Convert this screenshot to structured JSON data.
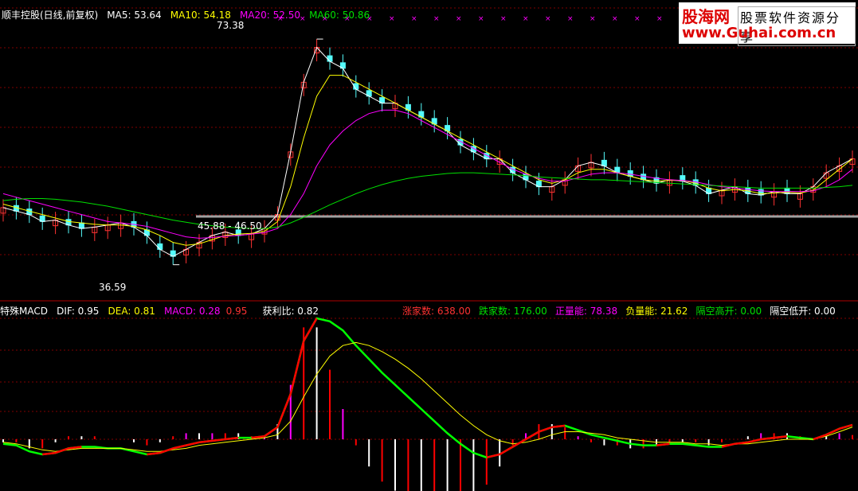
{
  "header": {
    "stock": "顺丰控股(日线,前复权)",
    "ma5": "MA5: 53.64",
    "ma10": "MA10: 54.18",
    "ma20": "MA20: 52.50",
    "ma60": "MA60: 50.86"
  },
  "macd_header": {
    "name": "特殊MACD",
    "dif": "DIF: 0.95",
    "dea": "DEA: 0.81",
    "macd_a": "MACD: 0.28",
    "macd_b": "0.95",
    "profit": "获利比: 0.82",
    "up_count": "涨家数: 638.00",
    "down_count": "跌家数: 176.00",
    "pos_vol": "正量能: 78.38",
    "neg_vol": "负量能: 21.62",
    "gap_up": "隔空高开: 0.00",
    "gap_down": "隔空低开: 0.00"
  },
  "logo": {
    "name": "股海网",
    "slogan": "股票软件资源分享",
    "url": "www.Guhai.com.cn"
  },
  "annotations": {
    "high": "73.38",
    "low": "36.59",
    "range": "45.88 - 46.50"
  },
  "colors": {
    "up": "#ff3232",
    "down": "#54fcfc",
    "ma5": "#ffffff",
    "ma10": "#ffff00",
    "ma20": "#ff00ff",
    "ma60": "#00e000",
    "grid": "#800000",
    "macd_up": "#ff0000",
    "macd_down": "#00ff00"
  },
  "chart_data": {
    "type": "line",
    "price_axis": [
      36.59,
      73.38
    ],
    "series": [
      {
        "name": "MA5",
        "values": [
          47,
          46.5,
          46,
          45,
          45.2,
          44.5,
          44,
          44.2,
          44.5,
          44.8,
          44.2,
          43,
          41,
          40,
          41,
          42,
          43,
          43.5,
          43,
          43.2,
          44,
          46,
          55,
          65,
          70,
          68,
          67,
          64,
          63,
          62,
          62,
          61,
          60,
          59,
          58,
          56,
          55,
          54,
          54,
          52,
          51,
          50,
          50,
          51,
          53,
          53.5,
          53,
          52,
          51.5,
          51,
          50.5,
          51,
          50.8,
          50.2,
          49,
          49.5,
          50,
          49,
          48.8,
          49.3,
          49,
          49,
          50,
          52,
          53,
          54
        ]
      },
      {
        "name": "MA10",
        "values": [
          47.5,
          47,
          46.5,
          46,
          45.5,
          45,
          44.8,
          44.6,
          44.5,
          44.5,
          44.3,
          43.8,
          43,
          42,
          41.6,
          41.8,
          42.4,
          43,
          43.2,
          43.3,
          43.6,
          45,
          50,
          57,
          63,
          66,
          66,
          65,
          64,
          63,
          62,
          61,
          60,
          59,
          58,
          57,
          56,
          55,
          54,
          53,
          52,
          51,
          50.5,
          51,
          52,
          52.5,
          52.5,
          52,
          51.5,
          51,
          50.8,
          50.9,
          50.9,
          50.5,
          49.8,
          49.4,
          49.6,
          49.4,
          49,
          49.1,
          49.2,
          49.1,
          49.5,
          51,
          52.5,
          54
        ]
      },
      {
        "name": "MA20",
        "values": [
          49,
          48.5,
          48,
          47.5,
          47,
          46.5,
          46,
          45.5,
          45,
          44.8,
          44.6,
          44.3,
          43.8,
          43.3,
          42.8,
          42.6,
          42.7,
          42.9,
          43,
          43.2,
          43.4,
          44,
          46,
          49,
          53,
          56,
          58,
          59.5,
          60.5,
          61,
          61,
          60.5,
          59.5,
          58.5,
          57.5,
          56.5,
          55.5,
          54.5,
          53.5,
          52.5,
          51.8,
          51.2,
          50.8,
          50.8,
          51.3,
          51.8,
          52,
          52,
          51.8,
          51.5,
          51.2,
          51,
          50.9,
          50.7,
          50.3,
          50,
          49.8,
          49.6,
          49.4,
          49.3,
          49.3,
          49.3,
          49.4,
          50,
          51,
          52.5
        ]
      },
      {
        "name": "MA60",
        "values": [
          48,
          48.2,
          48.3,
          48.3,
          48.2,
          48,
          47.8,
          47.5,
          47.2,
          46.8,
          46.4,
          46,
          45.6,
          45.2,
          44.9,
          44.6,
          44.4,
          44.2,
          44.1,
          44,
          44,
          44.2,
          44.8,
          45.6,
          46.5,
          47.4,
          48.2,
          49,
          49.7,
          50.3,
          50.8,
          51.2,
          51.5,
          51.7,
          51.9,
          52,
          52,
          51.9,
          51.8,
          51.7,
          51.6,
          51.4,
          51.3,
          51.2,
          51.1,
          51,
          51,
          50.9,
          50.8,
          50.7,
          50.6,
          50.5,
          50.4,
          50.3,
          50.2,
          50.1,
          50,
          49.9,
          49.8,
          49.8,
          49.8,
          49.8,
          49.8,
          49.9,
          50,
          50.2
        ]
      },
      {
        "name": "DIF",
        "values": [
          -0.3,
          -0.4,
          -0.8,
          -1.0,
          -0.9,
          -0.6,
          -0.5,
          -0.5,
          -0.6,
          -0.6,
          -0.8,
          -1.0,
          -0.9,
          -0.6,
          -0.4,
          -0.2,
          -0.1,
          0,
          0.1,
          0.1,
          0.2,
          0.8,
          3,
          6.5,
          8,
          7.8,
          7.2,
          6.2,
          5.3,
          4.4,
          3.6,
          2.8,
          2.0,
          1.2,
          0.4,
          -0.3,
          -0.9,
          -1.2,
          -1.0,
          -0.5,
          0,
          0.5,
          0.8,
          0.9,
          0.6,
          0.3,
          0.1,
          -0.1,
          -0.3,
          -0.4,
          -0.4,
          -0.3,
          -0.3,
          -0.4,
          -0.5,
          -0.5,
          -0.3,
          -0.2,
          0,
          0.1,
          0.2,
          0.1,
          0,
          0.3,
          0.7,
          0.95
        ]
      },
      {
        "name": "DEA",
        "values": [
          -0.2,
          -0.3,
          -0.5,
          -0.7,
          -0.8,
          -0.7,
          -0.6,
          -0.6,
          -0.6,
          -0.6,
          -0.7,
          -0.8,
          -0.8,
          -0.7,
          -0.6,
          -0.4,
          -0.3,
          -0.2,
          -0.1,
          0,
          0.1,
          0.3,
          1.2,
          2.8,
          4.3,
          5.5,
          6.2,
          6.4,
          6.2,
          5.8,
          5.3,
          4.7,
          4.0,
          3.2,
          2.4,
          1.6,
          0.9,
          0.3,
          -0.1,
          -0.3,
          -0.2,
          0,
          0.3,
          0.5,
          0.5,
          0.4,
          0.3,
          0.1,
          0,
          -0.1,
          -0.2,
          -0.2,
          -0.2,
          -0.3,
          -0.3,
          -0.4,
          -0.3,
          -0.3,
          -0.2,
          -0.1,
          0,
          0,
          0,
          0.2,
          0.5,
          0.81
        ]
      }
    ]
  }
}
